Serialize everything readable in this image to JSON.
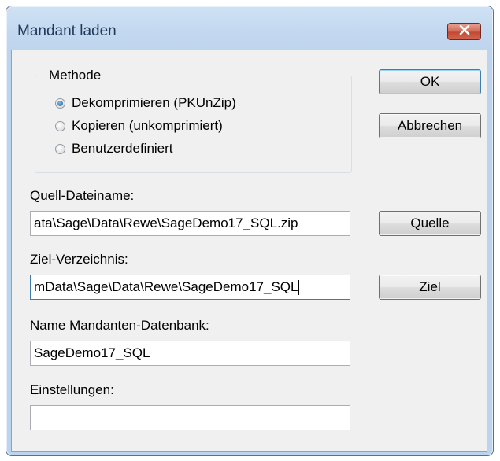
{
  "window": {
    "title": "Mandant laden",
    "close_icon": "close-icon"
  },
  "method_group": {
    "label": "Methode",
    "options": [
      {
        "label": "Dekomprimieren (PKUnZip)",
        "selected": true
      },
      {
        "label": "Kopieren (unkomprimiert)",
        "selected": false
      },
      {
        "label": "Benutzerdefiniert",
        "selected": false
      }
    ]
  },
  "buttons": {
    "ok": "OK",
    "cancel": "Abbrechen",
    "source": "Quelle",
    "target": "Ziel"
  },
  "fields": {
    "source_file": {
      "label": "Quell-Dateiname:",
      "value": "ata\\Sage\\Data\\Rewe\\SageDemo17_SQL.zip"
    },
    "target_dir": {
      "label": "Ziel-Verzeichnis:",
      "value": "mData\\Sage\\Data\\Rewe\\SageDemo17_SQL"
    },
    "db_name": {
      "label": "Name Mandanten-Datenbank:",
      "value": "SageDemo17_SQL"
    },
    "settings": {
      "label": "Einstellungen:",
      "value": ""
    }
  },
  "colors": {
    "title_text": "#1e395b",
    "frame": "#bdd4ee",
    "close_button": "#c24a33",
    "dialog_background": "#f0f0f0"
  }
}
